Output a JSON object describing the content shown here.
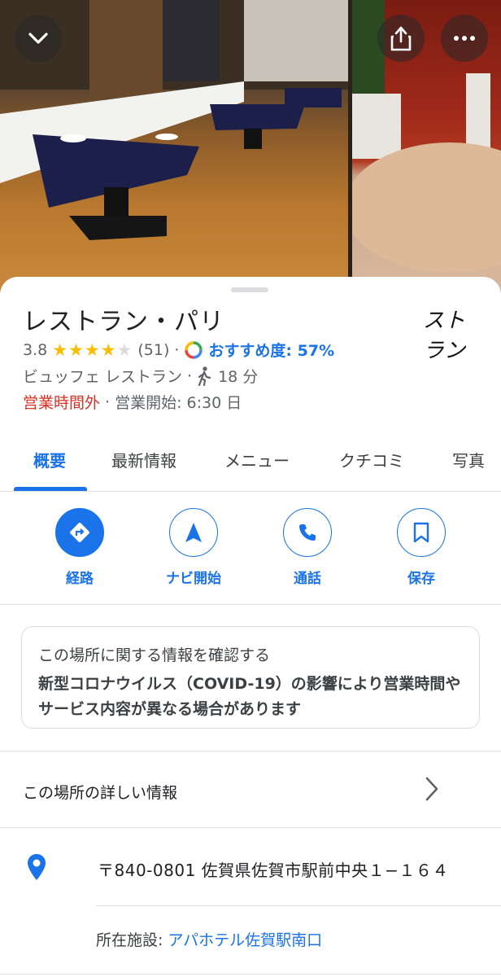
{
  "place": {
    "name": "レストラン・パリ",
    "rating": "3.8",
    "review_count": "(51)",
    "stars_filled": 4,
    "recommend": "おすすめ度: 57%",
    "category": "ビュッフェ レストラン",
    "walk_time": "18 分",
    "status": "営業時間外",
    "opens": "営業開始: 6:30 日",
    "logo_text": "ストラン"
  },
  "tabs": [
    {
      "label": "概要"
    },
    {
      "label": "最新情報"
    },
    {
      "label": "メニュー"
    },
    {
      "label": "クチコミ"
    },
    {
      "label": "写真"
    }
  ],
  "actions": [
    {
      "label": "経路"
    },
    {
      "label": "ナビ開始"
    },
    {
      "label": "通話"
    },
    {
      "label": "保存"
    }
  ],
  "notice": {
    "title": "この場所に関する情報を確認する",
    "body": "新型コロナウイルス（COVID-19）の影響により営業時間やサービス内容が異なる場合があります"
  },
  "details_label": "この場所の詳しい情報",
  "address": "〒840-0801 佐賀県佐賀市駅前中央１−１６４",
  "facility": {
    "label": "所在施設:",
    "name": "アパホテル佐賀駅南口"
  },
  "colors": {
    "accent": "#1a73e8",
    "closed": "#d93025",
    "star": "#fbbc04"
  }
}
